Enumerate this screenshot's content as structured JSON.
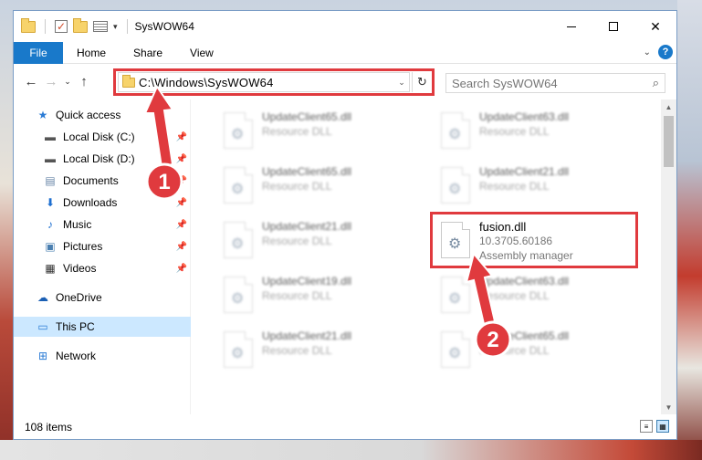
{
  "window": {
    "title": "SysWOW64"
  },
  "ribbon": {
    "tabs": [
      {
        "label": "File"
      },
      {
        "label": "Home"
      },
      {
        "label": "Share"
      },
      {
        "label": "View"
      }
    ]
  },
  "address": {
    "path": "C:\\Windows\\SysWOW64"
  },
  "search": {
    "placeholder": "Search SysWOW64"
  },
  "sidebar": {
    "items": [
      {
        "label": "Quick access",
        "icon": "star-icon"
      },
      {
        "label": "Local Disk (C:)",
        "icon": "drive-icon",
        "pinned": true
      },
      {
        "label": "Local Disk (D:)",
        "icon": "drive-icon",
        "pinned": true
      },
      {
        "label": "Documents",
        "icon": "documents-icon",
        "pinned": true
      },
      {
        "label": "Downloads",
        "icon": "download-icon",
        "pinned": true
      },
      {
        "label": "Music",
        "icon": "music-icon",
        "pinned": true
      },
      {
        "label": "Pictures",
        "icon": "pictures-icon",
        "pinned": true
      },
      {
        "label": "Videos",
        "icon": "videos-icon",
        "pinned": true
      },
      {
        "label": "OneDrive",
        "icon": "cloud-icon"
      },
      {
        "label": "This PC",
        "icon": "computer-icon",
        "selected": true
      },
      {
        "label": "Network",
        "icon": "network-icon"
      }
    ]
  },
  "files": [
    {
      "name": "UpdateClient65.dll",
      "type": "Resource DLL"
    },
    {
      "name": "UpdateClient63.dll",
      "type": "Resource DLL"
    },
    {
      "name": "UpdateClient65.dll",
      "type": "Resource DLL"
    },
    {
      "name": "UpdateClient21.dll",
      "type": "Resource DLL"
    },
    {
      "name": "UpdateClient21.dll",
      "type": "Resource DLL"
    },
    {
      "name": "fusion.dll",
      "version": "10.3705.60186",
      "type": "Assembly manager",
      "highlighted": true
    },
    {
      "name": "UpdateClient19.dll",
      "type": "Resource DLL"
    },
    {
      "name": "UpdateClient63.dll",
      "type": "Resource DLL"
    },
    {
      "name": "UpdateClient21.dll",
      "type": "Resource DLL"
    },
    {
      "name": "UpdateClient65.dll",
      "type": "Resource DLL"
    }
  ],
  "status": {
    "item_count": "108 items"
  },
  "callouts": [
    {
      "number": "1"
    },
    {
      "number": "2"
    }
  ],
  "colors": {
    "accent": "#1979ca",
    "highlight": "#e03a3e",
    "selected": "#cce8ff"
  }
}
